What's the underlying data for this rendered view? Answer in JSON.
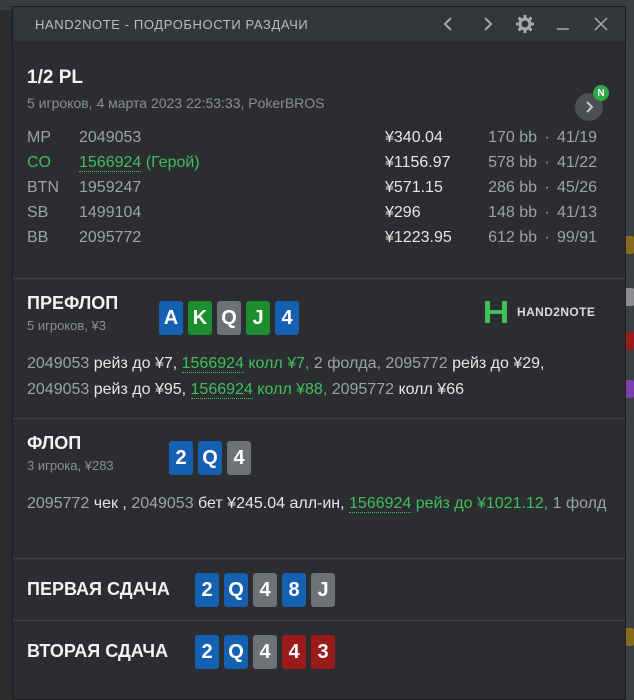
{
  "window": {
    "title": "HAND2NOTE - ПОДРОБНОСТИ РАЗДАЧИ"
  },
  "icons": {
    "prev": "chevron-left-icon",
    "next": "chevron-right-icon",
    "settings": "gear-icon",
    "minimize": "minimize-icon",
    "close": "close-icon"
  },
  "header": {
    "game": "1/2 PL",
    "subtitle": "5 игроков, 4 марта 2023 22:53:33, PokerBROS",
    "badge": "N",
    "players": [
      {
        "pos": "MP",
        "id": "2049053",
        "hero": "",
        "stack": "¥340.04",
        "bb": "170 bb",
        "dot": "·",
        "stat": "41/19"
      },
      {
        "pos": "CO",
        "id": "1566924",
        "hero": " (Герой)",
        "stack": "¥1156.97",
        "bb": "578 bb",
        "dot": "·",
        "stat": "41/22"
      },
      {
        "pos": "BTN",
        "id": "1959247",
        "hero": "",
        "stack": "¥571.15",
        "bb": "286 bb",
        "dot": "·",
        "stat": "45/26"
      },
      {
        "pos": "SB",
        "id": "1499104",
        "hero": "",
        "stack": "¥296",
        "bb": "148 bb",
        "dot": "·",
        "stat": "41/13"
      },
      {
        "pos": "BB",
        "id": "2095772",
        "hero": "",
        "stack": "¥1223.95",
        "bb": "612 bb",
        "dot": "·",
        "stat": "99/91"
      }
    ]
  },
  "logo": {
    "text": "HAND2NOTE"
  },
  "preflop": {
    "name": "ПРЕФЛОП",
    "sub": "5 игроков, ¥3",
    "cards": [
      "A",
      "K",
      "Q",
      "J",
      "4"
    ],
    "actions": {
      "p1": "2049053",
      "a1": " рейз до ¥7, ",
      "p2": "1566924",
      "a2": " колл ¥7,",
      "p3": " 2 фолда, 2095772",
      "a3": " рейз до ¥29, ",
      "p4": "2049053",
      "a4": " рейз до ¥95, ",
      "p5": "1566924",
      "a5": " колл ¥88,",
      "p6": " 2095772",
      "a6": " колл ¥66"
    }
  },
  "flop": {
    "name": "ФЛОП",
    "sub": "3 игрока, ¥283",
    "cards": [
      "2",
      "Q",
      "4"
    ],
    "actions": {
      "p1": "2095772",
      "a1": " чек , ",
      "p2": "2049053",
      "a2": " бет ¥245.04 алл-ин, ",
      "p3": "1566924",
      "a3": " рейз до ¥1021.12,",
      "p4": " 1 фолд"
    }
  },
  "run1": {
    "name": "ПЕРВАЯ СДАЧА",
    "cards": [
      "2",
      "Q",
      "4",
      "8",
      "J"
    ]
  },
  "run2": {
    "name": "ВТОРАЯ СДАЧА",
    "cards": [
      "2",
      "Q",
      "4",
      "4",
      "3"
    ]
  },
  "colors": {
    "hero": "#3fbf5c",
    "spade": "#6e7175",
    "heart": "#9b1a1a",
    "diamond": "#1560b0",
    "club": "#1d8e2f"
  }
}
